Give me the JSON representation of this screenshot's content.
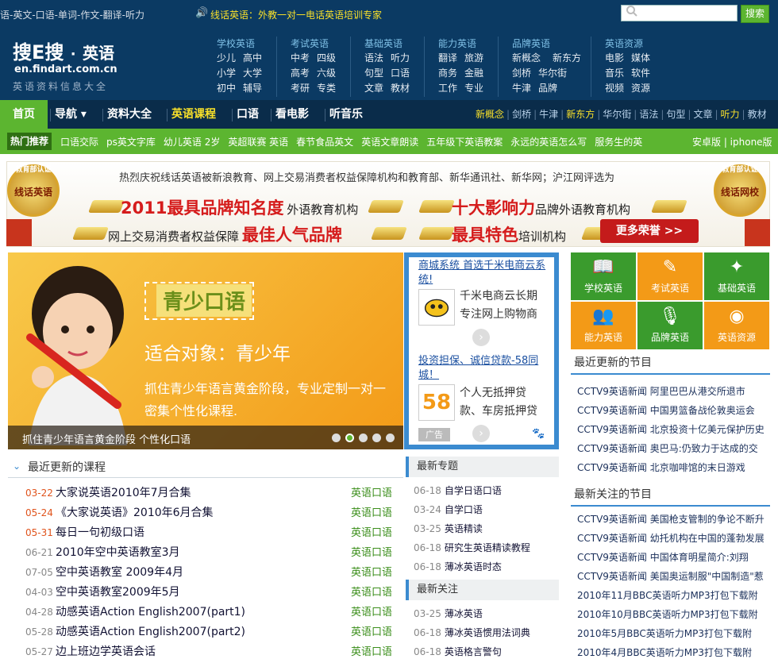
{
  "topbar": {
    "links": "语-英文-口语-单词-作文-翻译-听力",
    "promo": "线话英语：外教一对一电话英语培训专家",
    "search_button": "搜索",
    "search_placeholder": ""
  },
  "header": {
    "logo_main": "搜E搜",
    "logo_dot": "·",
    "logo_sub": "英语",
    "logo_url": "en.findart.com.cn",
    "logo_tagline": "英语资料信息大全",
    "categories": [
      {
        "title": "学校英语",
        "rows": [
          [
            "少儿",
            "高中"
          ],
          [
            "小学",
            "大学"
          ],
          [
            "初中",
            "辅导"
          ]
        ]
      },
      {
        "title": "考试英语",
        "rows": [
          [
            "中考",
            "四级"
          ],
          [
            "高考",
            "六级"
          ],
          [
            "考研",
            "专类"
          ]
        ]
      },
      {
        "title": "基础英语",
        "rows": [
          [
            "语法",
            "听力"
          ],
          [
            "句型",
            "口语"
          ],
          [
            "文章",
            "教材"
          ]
        ]
      },
      {
        "title": "能力英语",
        "rows": [
          [
            "翻译",
            "旅游"
          ],
          [
            "商务",
            "金融"
          ],
          [
            "工作",
            "专业"
          ]
        ]
      },
      {
        "title": "品牌英语",
        "rows": [
          [
            "新概念",
            "新东方"
          ],
          [
            "剑桥",
            "华尔街"
          ],
          [
            "牛津",
            "品牌"
          ]
        ]
      },
      {
        "title": "英语资源",
        "rows": [
          [
            "电影",
            "媒体"
          ],
          [
            "音乐",
            "软件"
          ],
          [
            "视频",
            "资源"
          ]
        ]
      }
    ]
  },
  "nav": {
    "home": "首页",
    "items": [
      "导航 ▾",
      "资料大全",
      "英语课程",
      "口语",
      "看电影",
      "听音乐"
    ],
    "right": [
      {
        "label": "新概念",
        "hl": true
      },
      {
        "label": "剑桥",
        "hl": false
      },
      {
        "label": "牛津",
        "hl": false
      },
      {
        "label": "新东方",
        "hl": true
      },
      {
        "label": "华尔街",
        "hl": false
      },
      {
        "label": "语法",
        "hl": false
      },
      {
        "label": "句型",
        "hl": false
      },
      {
        "label": "文章",
        "hl": false
      },
      {
        "label": "听力",
        "hl": true
      },
      {
        "label": "教材",
        "hl": false
      }
    ]
  },
  "hotbar": {
    "label": "热门推荐",
    "links": [
      "口语交际",
      "ps英文字库",
      "幼儿英语 2岁",
      "英超联赛 英语",
      "春节食品英文",
      "英语文章朗读",
      "五年级下英语教案",
      "永远的英语怎么写",
      "服务生的英"
    ],
    "right": "安卓版 | iphone版"
  },
  "banner": {
    "top_text": "热烈庆祝线话英语被新浪教育、网上交易消费者权益保障机构和教育部、新华通讯社、新华网；沪江网评选为",
    "award1_red": "2011最具品牌知名度",
    "award1_dark": "外语教育机构",
    "award2_red": "十大影响力",
    "award2_dark": "品牌外语教育机构",
    "award3_dark": "网上交易消费者权益保障",
    "award3_red": "最佳人气品牌",
    "award4_red": "最具特色",
    "award4_dark": "培训机构",
    "honor_button": "更多荣誉 >>",
    "medal_left_top": "教育部认证",
    "medal_left": "线话英语",
    "medal_right_top": "教育部认证",
    "medal_right": "线话网校"
  },
  "slider": {
    "title": "青少口语",
    "subtitle": "适合对象：青少年",
    "desc": "抓住青少年语言黄金阶段，专业定制一对一密集个性化课程.",
    "caption": "抓住青少年语言黄金阶段 个性化口语",
    "dots": 5,
    "active_dot": 1
  },
  "ads": [
    {
      "title": "商城系统 首选千米电商云系统!",
      "text": "千米电商云长期专注网上购物商"
    },
    {
      "title": "投资担保、诚信贷款-58同城！",
      "text": "个人无抵押贷款、车房抵押贷",
      "icon_text": "58"
    }
  ],
  "ad_label": "广告",
  "tiles": [
    {
      "label": "学校英语",
      "icon": "book-icon",
      "color": "#3a9b2d"
    },
    {
      "label": "考试英语",
      "icon": "pencil-icon",
      "color": "#f39a17"
    },
    {
      "label": "基础英语",
      "icon": "wand-icon",
      "color": "#3a9b2d"
    },
    {
      "label": "能力英语",
      "icon": "people-icon",
      "color": "#f39a17"
    },
    {
      "label": "品牌英语",
      "icon": "microphone-icon",
      "color": "#3a9b2d"
    },
    {
      "label": "英语资源",
      "icon": "rss-icon",
      "color": "#f39a17"
    }
  ],
  "courses": {
    "title": "最近更新的课程",
    "rows": [
      {
        "date": "03-22",
        "title": "大家说英语2010年7月合集",
        "cat": "英语口语",
        "red": true
      },
      {
        "date": "05-24",
        "title": "《大家说英语》2010年6月合集",
        "cat": "英语口语",
        "red": true
      },
      {
        "date": "05-31",
        "title": "每日一句初级口语",
        "cat": "英语口语",
        "red": true
      },
      {
        "date": "06-21",
        "title": "2010年空中英语教室3月",
        "cat": "英语口语",
        "red": false
      },
      {
        "date": "07-05",
        "title": "空中英语教室 2009年4月",
        "cat": "英语口语",
        "red": false
      },
      {
        "date": "04-03",
        "title": "空中英语教室2009年5月",
        "cat": "英语口语",
        "red": false
      },
      {
        "date": "04-28",
        "title": "动感英语Action English2007(part1)",
        "cat": "英语口语",
        "red": false
      },
      {
        "date": "05-28",
        "title": "动感英语Action English2007(part2)",
        "cat": "英语口语",
        "red": false
      },
      {
        "date": "05-27",
        "title": "边上班边学英语会话",
        "cat": "英语口语",
        "red": false
      }
    ]
  },
  "topics": {
    "title": "最新专题",
    "rows": [
      {
        "date": "06-18",
        "title": "自学日语口语"
      },
      {
        "date": "03-24",
        "title": "自学口语"
      },
      {
        "date": "03-25",
        "title": "英语精读"
      },
      {
        "date": "06-18",
        "title": "研究生英语精读教程"
      },
      {
        "date": "06-18",
        "title": "薄冰英语时态"
      }
    ]
  },
  "follows": {
    "title": "最新关注",
    "rows": [
      {
        "date": "03-25",
        "title": "薄冰英语"
      },
      {
        "date": "06-18",
        "title": "薄冰英语惯用法词典"
      },
      {
        "date": "06-18",
        "title": "英语格言警句"
      }
    ]
  },
  "programs": {
    "title": "最近更新的节目",
    "rows": [
      "CCTV9英语新闻 阿里巴巴从港交所退市",
      "CCTV9英语新闻 中国男篮备战伦敦奥运会",
      "CCTV9英语新闻 北京投资十亿美元保护历史",
      "CCTV9英语新闻 奥巴马:仍致力于达成的交",
      "CCTV9英语新闻 北京咖啡馆的末日游戏"
    ]
  },
  "attention": {
    "title": "最新关注的节目",
    "rows": [
      "CCTV9英语新闻 美国枪支管制的争论不断升",
      "CCTV9英语新闻 幼托机构在中国的蓬勃发展",
      "CCTV9英语新闻 中国体育明星简介:刘翔",
      "CCTV9英语新闻 美国奥运制服\"中国制造\"惹",
      "2010年11月BBC英语听力MP3打包下载附",
      "2010年10月BBC英语听力MP3打包下载附",
      "2010年5月BBC英语听力MP3打包下载附",
      "2010年4月BBC英语听力MP3打包下载附"
    ]
  }
}
